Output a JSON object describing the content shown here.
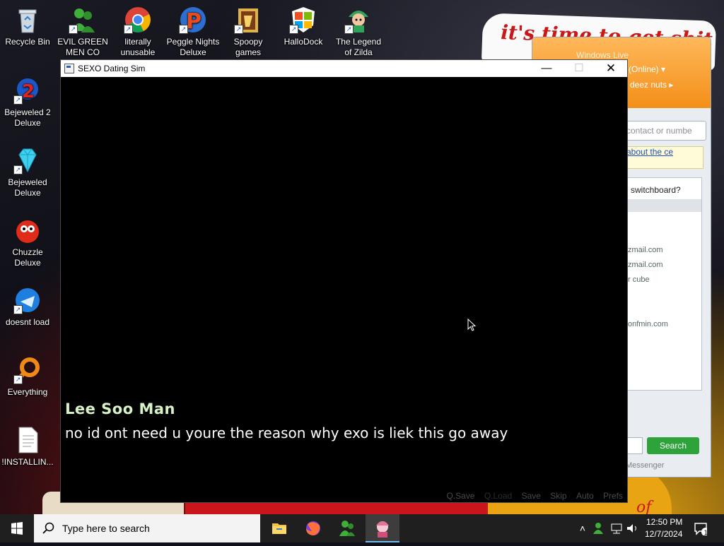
{
  "desktop": {
    "icons": [
      {
        "label": "Recycle Bin"
      },
      {
        "label": "EVIL GREEN MEN CO"
      },
      {
        "label": "literally unusable"
      },
      {
        "label": "Peggle Nights Deluxe"
      },
      {
        "label": "Spoopy games"
      },
      {
        "label": "HalloDock"
      },
      {
        "label": "The Legend of Zilda"
      },
      {
        "label": "Bejeweled 2 Deluxe"
      },
      {
        "label": "Bejeweled Deluxe"
      },
      {
        "label": "Chuzzle Deluxe"
      },
      {
        "label": "doesnt load"
      },
      {
        "label": "Everything"
      },
      {
        "label": "!INSTALLIN..."
      }
    ],
    "wallpaper_text": "it's time to get shit",
    "wallpaper_text_2": "of"
  },
  "messenger": {
    "title": "Windows Live",
    "status": "(Online) ▾",
    "nick": "deez nuts ▸",
    "search_placeholder": "contact or numbe",
    "news_link": "about the ce",
    "switchboard": "switchboard?",
    "contacts": [
      "zmail.com",
      "zmail.com",
      "r cube",
      "onfmin.com"
    ],
    "search_button": "Search",
    "brand": "Messenger"
  },
  "game": {
    "window_title": "SEXO Dating Sim",
    "speaker": "Lee Soo Man",
    "dialogue": "no id ont need u youre the reason why exo is liek this go away",
    "quick_menu": {
      "qsave": "Q.Save",
      "qload": "Q.Load",
      "save": "Save",
      "skip": "Skip",
      "auto": "Auto",
      "prefs": "Prefs"
    }
  },
  "taskbar": {
    "search_placeholder": "Type here to search",
    "time": "12:50 PM",
    "date": "12/7/2024",
    "notification_count": "1"
  }
}
